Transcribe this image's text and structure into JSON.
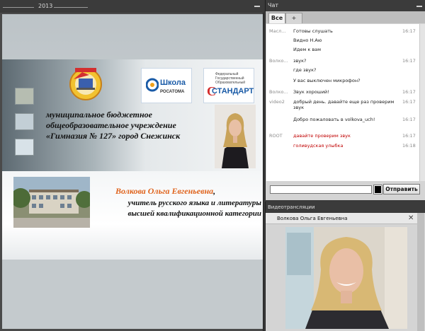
{
  "presentation": {
    "year_label": "2013",
    "school_name": "муниципальное бюджетное общеобразовательное учреждение «Гимназия № 127» город Снежинск",
    "logo_rosatom": {
      "title": "Школа",
      "subtitle": "РОСАТОМА"
    },
    "logo_standard": {
      "small": "Федеральный Государственный Образовательный",
      "big": "СТАНДАРТ"
    },
    "teacher_name": "Волкова Ольга Евгеньевна",
    "teacher_comma": ",",
    "teacher_title": "учитель русского языка и литературы высшей квалификационной категории"
  },
  "chat": {
    "title": "Чат",
    "tabs": [
      {
        "label": "Все"
      },
      {
        "label": "+"
      }
    ],
    "messages": [
      {
        "sender": "Масл...",
        "text": "Готовы слушать",
        "time": "16:17",
        "red": false
      },
      {
        "sender": "",
        "text": "Видно Н.Аю",
        "time": "",
        "red": false
      },
      {
        "sender": "",
        "text": "Идем к вам",
        "time": "",
        "red": false
      },
      {
        "sender": "Волко...",
        "text": "звук?",
        "time": "16:17",
        "red": false
      },
      {
        "sender": "",
        "text": "где звук?",
        "time": "",
        "red": false
      },
      {
        "sender": "",
        "text": "У вас выключен микрофон?",
        "time": "",
        "red": false
      },
      {
        "sender": "Волко...",
        "text": "Звук хороший!",
        "time": "16:17",
        "red": false
      },
      {
        "sender": "video2",
        "text": "добрый день. давайте еще раз проверим звук",
        "time": "16:17",
        "red": false
      },
      {
        "sender": "",
        "text": "Добро пожаловать в volkova_uch!",
        "time": "16:17",
        "red": false
      },
      {
        "sender": "ROOT",
        "text": "давайте проверим звук",
        "time": "16:17",
        "red": true
      },
      {
        "sender": "",
        "text": "голивудская улыбка",
        "time": "16:18",
        "red": true
      }
    ],
    "input_value": "",
    "send_label": "Отправить"
  },
  "video": {
    "title": "Видеотрансляции",
    "stream_name": "Волкова Ольга Евгеньевна",
    "close_glyph": "✕"
  },
  "colors": {
    "accent_orange": "#e0651f",
    "message_red": "#c00000",
    "panel_dark": "#3b3b3b"
  }
}
